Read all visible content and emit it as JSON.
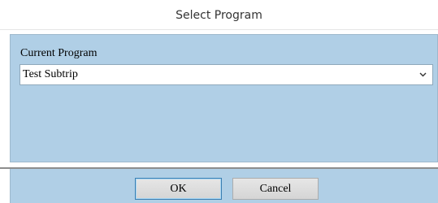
{
  "window": {
    "title": "Select Program"
  },
  "form": {
    "current_program_label": "Current Program",
    "current_program_value": "Test Subtrip"
  },
  "buttons": {
    "ok_label": "OK",
    "cancel_label": "Cancel"
  },
  "colors": {
    "panel_background": "#b0cfe6",
    "default_button_border": "#3c7fb1"
  },
  "icons": {
    "dropdown": "chevron-down-icon"
  }
}
